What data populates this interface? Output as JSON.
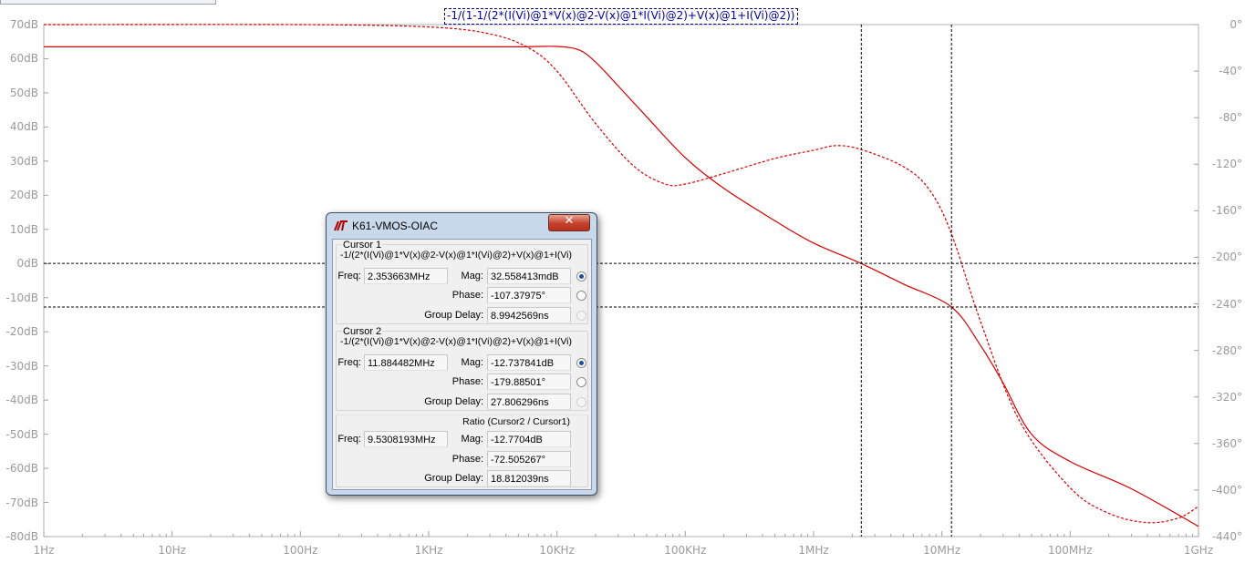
{
  "window": {
    "trace_expression": "-1/(1-1/(2*(I(Vi)@1*V(x)@2-V(x)@1*I(Vi)@2)+V(x)@1+I(Vi)@2))"
  },
  "axes": {
    "y_left_labels": [
      "70dB",
      "60dB",
      "50dB",
      "40dB",
      "30dB",
      "20dB",
      "10dB",
      "0dB",
      "-10dB",
      "-20dB",
      "-30dB",
      "-40dB",
      "-50dB",
      "-60dB",
      "-70dB",
      "-80dB"
    ],
    "y_right_labels": [
      "0°",
      "-40°",
      "-80°",
      "-120°",
      "-160°",
      "-200°",
      "-240°",
      "-280°",
      "-320°",
      "-360°",
      "-400°",
      "-440°"
    ],
    "x_labels": [
      "1Hz",
      "10Hz",
      "100Hz",
      "1KHz",
      "10KHz",
      "100KHz",
      "1MHz",
      "10MHz",
      "100MHz",
      "1GHz"
    ]
  },
  "chart_data": {
    "type": "line",
    "xscale": "log",
    "xlim": [
      1,
      1000000000
    ],
    "ylim_left_db": [
      -80,
      70
    ],
    "ylim_right_deg": [
      -440,
      0
    ],
    "grid": false,
    "colors": {
      "trace": "#d40000",
      "cursor": "#000000",
      "axis_text": "#9a9a9a"
    },
    "series": [
      {
        "style": "solid",
        "axis": "left",
        "x": [
          1,
          10,
          100,
          1000,
          5000,
          10000,
          15000,
          20000,
          30000,
          50000,
          100000,
          200000,
          500000,
          1000000,
          2353663,
          5000000,
          11884482,
          20000000,
          30000000,
          50000000,
          100000000,
          300000000,
          1000000000
        ],
        "y": [
          63.5,
          63.5,
          63.5,
          63.5,
          63.5,
          63.6,
          62.5,
          59,
          52,
          43,
          31,
          22,
          12.5,
          6,
          0,
          -6,
          -12.74,
          -24,
          -35,
          -50,
          -58,
          -66,
          -77
        ]
      },
      {
        "style": "dashed",
        "axis": "right",
        "x": [
          1,
          100,
          1000,
          3000,
          6000,
          10000,
          20000,
          40000,
          70000,
          100000,
          200000,
          500000,
          1000000,
          1500000,
          2353663,
          5000000,
          8000000,
          11884482,
          20000000,
          40000000,
          100000000,
          200000000,
          400000000,
          700000000,
          1000000000
        ],
        "y": [
          0,
          0,
          -2,
          -8,
          -20,
          -40,
          -85,
          -122,
          -137,
          -137,
          -128,
          -115,
          -108,
          -104,
          -107.38,
          -122,
          -142,
          -179.89,
          -255,
          -340,
          -398,
          -420,
          -428,
          -424,
          -414
        ]
      }
    ],
    "cursors": [
      {
        "freq_hz": 2353663,
        "mag_db": 32.558413
      },
      {
        "freq_hz": 11884482,
        "mag_db": -12.737841
      }
    ]
  },
  "dialog": {
    "title": "K61-VMOS-OIAC",
    "close_label": "✕",
    "cursor1": {
      "title": "Cursor 1",
      "expression": "-1/(2*(I(Vi)@1*V(x)@2-V(x)@1*I(Vi)@2)+V(x)@1+I(Vi)",
      "freq_label": "Freq:",
      "freq": "2.353663MHz",
      "mag_label": "Mag:",
      "mag": "32.558413mdB",
      "phase_label": "Phase:",
      "phase": "-107.37975°",
      "gd_label": "Group Delay:",
      "gd": "8.9942569ns"
    },
    "cursor2": {
      "title": "Cursor 2",
      "expression": "-1/(2*(I(Vi)@1*V(x)@2-V(x)@1*I(Vi)@2)+V(x)@1+I(Vi)",
      "freq_label": "Freq:",
      "freq": "11.884482MHz",
      "mag_label": "Mag:",
      "mag": "-12.737841dB",
      "phase_label": "Phase:",
      "phase": "-179.88501°",
      "gd_label": "Group Delay:",
      "gd": "27.806296ns"
    },
    "ratio": {
      "title": "Ratio (Cursor2 / Cursor1)",
      "freq_label": "Freq:",
      "freq": "9.5308193MHz",
      "mag_label": "Mag:",
      "mag": "-12.7704dB",
      "phase_label": "Phase:",
      "phase": "-72.505267°",
      "gd_label": "Group Delay:",
      "gd": "18.812039ns"
    }
  }
}
